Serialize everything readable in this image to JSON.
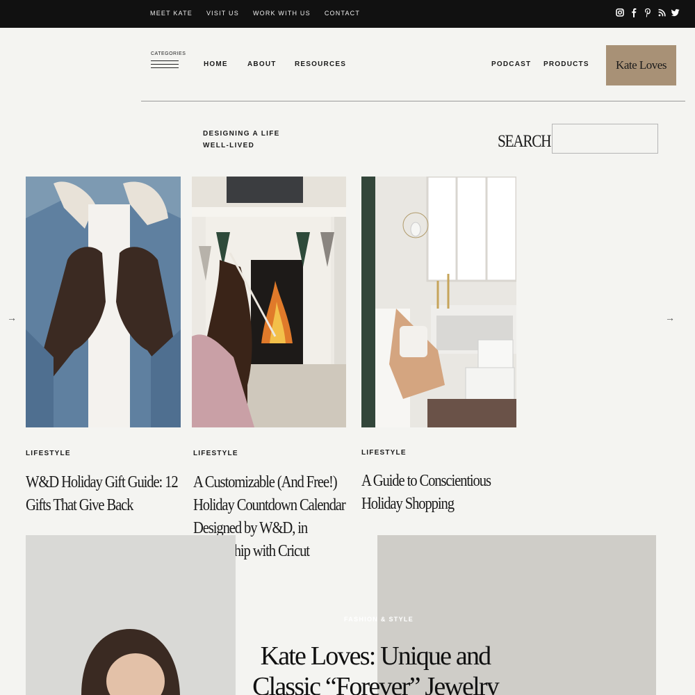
{
  "topbar": {
    "links": [
      "MEET KATE",
      "VISIT US",
      "WORK WITH US",
      "CONTACT"
    ],
    "social_icons": [
      "instagram-icon",
      "facebook-icon",
      "pinterest-icon",
      "rss-icon",
      "twitter-icon"
    ]
  },
  "header": {
    "categories_label": "CATEGORIES",
    "nav": {
      "home": "HOME",
      "about": "ABOUT",
      "resources": "RESOURCES",
      "podcast": "PODCAST",
      "products": "PRODUCTS"
    },
    "brand_button": "Kate Loves",
    "brand_color": "#a89176"
  },
  "hero": {
    "tagline_line1": "DESIGNING A LIFE",
    "tagline_line2": "WELL-LIVED",
    "search_label": "SEARCH",
    "search_value": ""
  },
  "carousel": {
    "prev_arrow": "→",
    "next_arrow": "→",
    "cards": [
      {
        "category": "LIFESTYLE",
        "title": "W&D Holiday Gift Guide: 12 Gifts That Give Back"
      },
      {
        "category": "LIFESTYLE",
        "title": "A Customizable (And Free!) Holiday Countdown Calendar Designed by W&D, in Partnership with Cricut"
      },
      {
        "category": "LIFESTYLE",
        "title": "A Guide to Conscientious Holiday Shopping"
      }
    ]
  },
  "featured": {
    "category": "FASHION & STYLE",
    "title": "Kate Loves: Unique and Classic “Forever” Jewelry"
  }
}
